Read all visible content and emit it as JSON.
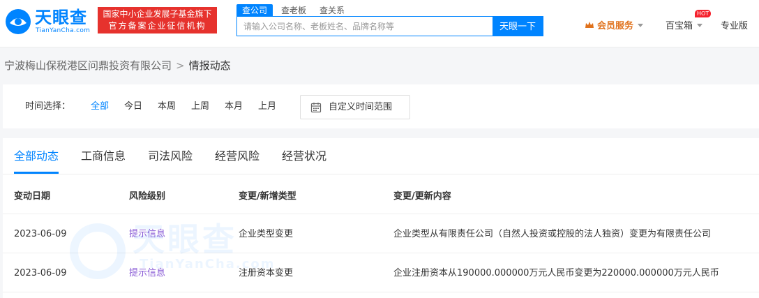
{
  "header": {
    "logo_text": "天眼查",
    "logo_sub": "TianYanCha.com",
    "fund_badge": [
      "国家中小企业发展子基金旗下",
      "官方备案企业征信机构"
    ],
    "search_tabs": [
      "查公司",
      "查老板",
      "查关系"
    ],
    "search_placeholder": "请输入公司名称、老板姓名、品牌名称等",
    "search_button": "天眼一下",
    "member_label": "会员服务",
    "treasure_label": "百宝箱",
    "hot_badge": "HOT",
    "pro_label": "专业版"
  },
  "breadcrumb": {
    "company": "宁波梅山保税港区问鼎投资有限公司",
    "separator": ">",
    "current": "情报动态"
  },
  "time_filter": {
    "label": "时间选择：",
    "options": [
      "全部",
      "今日",
      "本周",
      "上周",
      "本月",
      "上月"
    ],
    "active_index": 0,
    "custom_label": "自定义时间范围"
  },
  "tabs": {
    "items": [
      "全部动态",
      "工商信息",
      "司法风险",
      "经营风险",
      "经营状况"
    ],
    "active_index": 0
  },
  "table": {
    "columns": [
      "变动日期",
      "风险级别",
      "变更/新增类型",
      "变更/更新内容"
    ],
    "rows": [
      {
        "date": "2023-06-09",
        "risk": "提示信息",
        "type": "企业类型变更",
        "content": "企业类型从有限责任公司（自然人投资或控股的法人独资）变更为有限责任公司"
      },
      {
        "date": "2023-06-09",
        "risk": "提示信息",
        "type": "注册资本变更",
        "content": "企业注册资本从190000.000000万元人民币变更为220000.000000万元人民币"
      }
    ]
  },
  "watermark": {
    "text": "天眼查",
    "sub": "TianYanCha.com"
  },
  "colors": {
    "accent": "#0084ff",
    "badge_red": "#e6322d",
    "member_orange": "#e0721d",
    "risk_purple": "#8a5cd6"
  }
}
